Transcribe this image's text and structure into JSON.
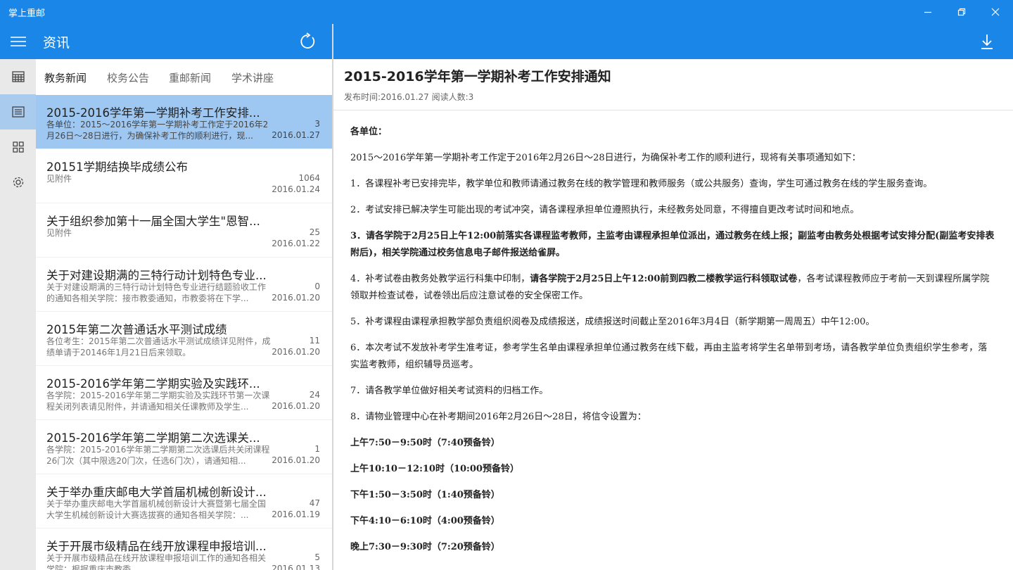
{
  "window": {
    "title": "掌上重邮"
  },
  "list_panel": {
    "title": "资讯"
  },
  "tabs": [
    {
      "label": "教务新闻"
    },
    {
      "label": "校务公告"
    },
    {
      "label": "重邮新闻"
    },
    {
      "label": "学术讲座"
    }
  ],
  "news": [
    {
      "title": "2015-2016学年第一学期补考工作安排...",
      "summary": "各单位：2015～2016学年第一学期补考工作定于2016年2月26日～28日进行，为确保补考工作的顺利进行，现...",
      "count": "3",
      "date": "2016.01.27"
    },
    {
      "title": "20151学期结换毕成绩公布",
      "summary": "见附件",
      "count": "1064",
      "date": "2016.01.24"
    },
    {
      "title": "关于组织参加第十一届全国大学生\"恩智...",
      "summary": "见附件",
      "count": "25",
      "date": "2016.01.22"
    },
    {
      "title": "关于对建设期满的三特行动计划特色专业...",
      "summary": "关于对建设期满的三特行动计划特色专业进行结题验收工作的通知各相关学院：接市教委通知，市教委将在下学...",
      "count": "0",
      "date": "2016.01.20"
    },
    {
      "title": "2015年第二次普通话水平测试成绩",
      "summary": "各位考生：2015年第二次普通话水平测试成绩详见附件，成绩单请于20146年1月21日后来领取。",
      "count": "11",
      "date": "2016.01.20"
    },
    {
      "title": "2015-2016学年第二学期实验及实践环...",
      "summary": "各学院：2015-2016学年第二学期实验及实践环节第一次课程关闭列表请见附件，并请通知相关任课教师及学生...",
      "count": "24",
      "date": "2016.01.20"
    },
    {
      "title": "2015-2016学年第二学期第二次选课关...",
      "summary": "各学院：2015-2016学年第二学期第二次选课后共关闭课程26门次（其中限选20门次，任选6门次），请通知相...",
      "count": "1",
      "date": "2016.01.20"
    },
    {
      "title": "关于举办重庆邮电大学首届机械创新设计...",
      "summary": "关于举办重庆邮电大学首届机械创新设计大赛暨第七届全国大学生机械创新设计大赛选拔赛的通知各相关学院：...",
      "count": "47",
      "date": "2016.01.19"
    },
    {
      "title": "关于开展市级精品在线开放课程申报培训...",
      "summary": "关于开展市级精品在线开放课程申报培训工作的通知各相关学院：根据重庆市教委",
      "count": "5",
      "date": "2016.01.13"
    }
  ],
  "article": {
    "title": "2015-2016学年第一学期补考工作安排通知",
    "meta": "发布时间:2016.01.27 阅读人数:3",
    "greeting": "各单位：",
    "intro": "2015～2016学年第一学期补考工作定于2016年2月26日～28日进行，为确保补考工作的顺利进行，现将有关事项通知如下：",
    "p1": "1．各课程补考已安排完毕，教学单位和教师请通过教务在线的教学管理和教师服务（或公共服务）查询，学生可通过教务在线的学生服务查询。",
    "p2": "2．考试安排已解决学生可能出现的考试冲突，请各课程承担单位遵照执行，未经教务处同意，不得擅自更改考试时间和地点。",
    "p3": "3．请各学院于2月25日上午12:00前落实各课程监考教师，主监考由课程承担单位派出，通过教务在线上报；副监考由教务处根据考试安排分配(副监考安排表附后)，相关学院通过校务信息电子邮件报送给雀屏。",
    "p4_a": "4．补考试卷由教务处教学运行科集中印制，",
    "p4_b": "请各学院于2月25日上午12:00前到四教二楼教学运行科领取试卷",
    "p4_c": "，各考试课程教师应于考前一天到课程所属学院领取并检查试卷，试卷领出后应注意试卷的安全保密工作。",
    "p5": "5．补考课程由课程承担教学部负责组织阅卷及成绩报送，成绩报送时间截止至2016年3月4日（新学期第一周周五）中午12:00。",
    "p6": "6．本次考试不发放补考学生准考证，参考学生名单由课程承担单位通过教务在线下载，再由主监考将学生名单带到考场，请各教学单位负责组织学生参考，落实监考教师，组织辅导员巡考。",
    "p7": "7．请各教学单位做好相关考试资料的归档工作。",
    "p8": "8．请物业管理中心在补考期间2016年2月26日～28日，将信令设置为：",
    "bells": [
      "上午7:50－9:50时（7:40预备铃）",
      "上午10:10－12:10时（10:00预备铃）",
      "下午1:50－3:50时（1:40预备铃）",
      "下午4:10－6:10时（4:00预备铃）",
      "晚上7:30－9:30时（7:20预备铃）"
    ]
  },
  "icons": {
    "minimize": "minimize-icon",
    "maximize": "restore-icon",
    "close": "close-icon",
    "menu": "hamburger-icon",
    "refresh": "refresh-icon",
    "download": "download-icon"
  },
  "colors": {
    "accent": "#1a86e8",
    "selected": "#9ec8f2",
    "rail": "#e9e9e9"
  }
}
